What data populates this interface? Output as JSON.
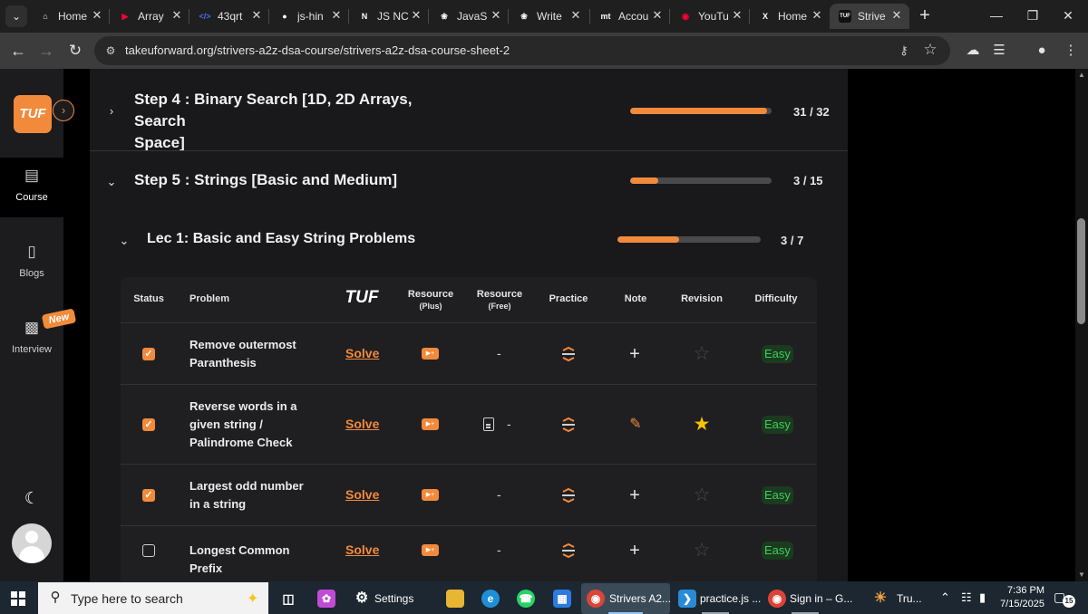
{
  "browser": {
    "tabs": [
      {
        "label": "Home",
        "icon": "home-icon",
        "color": "#e3e3e3"
      },
      {
        "label": "Array",
        "icon": "youtube-icon",
        "color": "#ff0033"
      },
      {
        "label": "43qrt",
        "icon": "code-icon",
        "color": "#4b6cff"
      },
      {
        "label": "js-hin",
        "icon": "github-icon",
        "color": "#ffffff"
      },
      {
        "label": "JS NC",
        "icon": "notion-icon",
        "color": "#ffffff"
      },
      {
        "label": "JavaS",
        "icon": "openai-icon",
        "color": "#ffffff"
      },
      {
        "label": "Write",
        "icon": "openai-icon",
        "color": "#ffffff"
      },
      {
        "label": "Accou",
        "icon": "mt-icon",
        "color": "#ffffff"
      },
      {
        "label": "YouTu",
        "icon": "youtube-music-icon",
        "color": "#ff0033"
      },
      {
        "label": "Home",
        "icon": "x-icon",
        "color": "#ffffff"
      },
      {
        "label": "Strive",
        "icon": "tuf-icon",
        "color": "#ffffff"
      }
    ],
    "url": "takeuforward.org/strivers-a2z-dsa-course/strivers-a2z-dsa-course-sheet-2"
  },
  "sidebar": {
    "logo": "TUF",
    "items": [
      {
        "label": "Course",
        "icon": "book-icon"
      },
      {
        "label": "Blogs",
        "icon": "bookmark-icon"
      },
      {
        "label": "Interview",
        "icon": "briefcase-icon"
      }
    ],
    "new_badge": "New"
  },
  "steps": [
    {
      "title_line1": "Step 4 : Binary Search [1D, 2D Arrays, Search",
      "title_line2": "Space]",
      "done": 31,
      "total": 32,
      "count": "31 / 32"
    },
    {
      "title_line1": "Step 5 : Strings [Basic and Medium]",
      "done": 3,
      "total": 15,
      "count": "3 / 15"
    }
  ],
  "lecture": {
    "title": "Lec 1: Basic and Easy String Problems",
    "done": 3,
    "total": 7,
    "count": "3 / 7"
  },
  "table": {
    "headers": {
      "status": "Status",
      "problem": "Problem",
      "tuf": "TUF",
      "resource_plus": "Resource",
      "resource_plus_sub": "(Plus)",
      "resource_free": "Resource",
      "resource_free_sub": "(Free)",
      "practice": "Practice",
      "note": "Note",
      "revision": "Revision",
      "difficulty": "Difficulty"
    },
    "rows": [
      {
        "checked": true,
        "problem": "Remove outermost Paranthesis",
        "solve": "Solve",
        "resource_free": "-",
        "note": "+",
        "revision_starred": false,
        "difficulty": "Easy"
      },
      {
        "checked": true,
        "problem": "Reverse words in a given string / Palindrome Check",
        "solve": "Solve",
        "resource_free": "-",
        "note": "edit",
        "revision_starred": true,
        "difficulty": "Easy"
      },
      {
        "checked": true,
        "problem": "Largest odd number in a string",
        "solve": "Solve",
        "resource_free": "-",
        "note": "+",
        "revision_starred": false,
        "difficulty": "Easy"
      },
      {
        "checked": false,
        "problem": "Longest Common Prefix",
        "solve": "Solve",
        "resource_free": "-",
        "note": "+",
        "revision_starred": false,
        "difficulty": "Easy"
      }
    ]
  },
  "taskbar": {
    "search_placeholder": "Type here to search",
    "apps": [
      {
        "label": "Settings"
      },
      {
        "label": "Strivers A2..."
      },
      {
        "label": "practice.js ..."
      },
      {
        "label": "Sign in – G..."
      },
      {
        "label": "Tru..."
      }
    ],
    "time": "7:36 PM",
    "date": "7/15/2025",
    "notifications": "15"
  },
  "colors": {
    "accent": "#f28a3c",
    "easy": "#3fce5b",
    "star": "#f7c400"
  }
}
